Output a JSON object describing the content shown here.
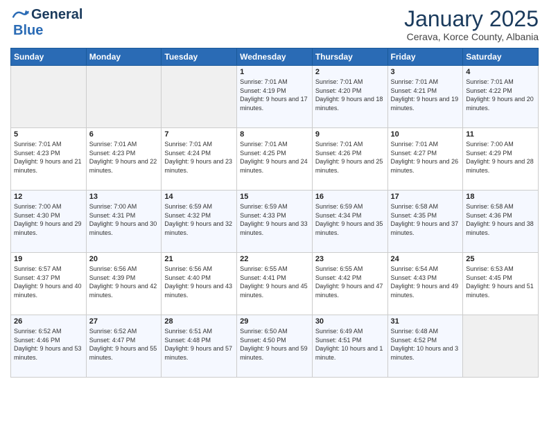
{
  "header": {
    "logo_line1": "General",
    "logo_line2": "Blue",
    "month": "January 2025",
    "location": "Cerava, Korce County, Albania"
  },
  "days_of_week": [
    "Sunday",
    "Monday",
    "Tuesday",
    "Wednesday",
    "Thursday",
    "Friday",
    "Saturday"
  ],
  "weeks": [
    [
      {
        "day": "",
        "info": ""
      },
      {
        "day": "",
        "info": ""
      },
      {
        "day": "",
        "info": ""
      },
      {
        "day": "1",
        "info": "Sunrise: 7:01 AM\nSunset: 4:19 PM\nDaylight: 9 hours and 17 minutes."
      },
      {
        "day": "2",
        "info": "Sunrise: 7:01 AM\nSunset: 4:20 PM\nDaylight: 9 hours and 18 minutes."
      },
      {
        "day": "3",
        "info": "Sunrise: 7:01 AM\nSunset: 4:21 PM\nDaylight: 9 hours and 19 minutes."
      },
      {
        "day": "4",
        "info": "Sunrise: 7:01 AM\nSunset: 4:22 PM\nDaylight: 9 hours and 20 minutes."
      }
    ],
    [
      {
        "day": "5",
        "info": "Sunrise: 7:01 AM\nSunset: 4:23 PM\nDaylight: 9 hours and 21 minutes."
      },
      {
        "day": "6",
        "info": "Sunrise: 7:01 AM\nSunset: 4:23 PM\nDaylight: 9 hours and 22 minutes."
      },
      {
        "day": "7",
        "info": "Sunrise: 7:01 AM\nSunset: 4:24 PM\nDaylight: 9 hours and 23 minutes."
      },
      {
        "day": "8",
        "info": "Sunrise: 7:01 AM\nSunset: 4:25 PM\nDaylight: 9 hours and 24 minutes."
      },
      {
        "day": "9",
        "info": "Sunrise: 7:01 AM\nSunset: 4:26 PM\nDaylight: 9 hours and 25 minutes."
      },
      {
        "day": "10",
        "info": "Sunrise: 7:01 AM\nSunset: 4:27 PM\nDaylight: 9 hours and 26 minutes."
      },
      {
        "day": "11",
        "info": "Sunrise: 7:00 AM\nSunset: 4:29 PM\nDaylight: 9 hours and 28 minutes."
      }
    ],
    [
      {
        "day": "12",
        "info": "Sunrise: 7:00 AM\nSunset: 4:30 PM\nDaylight: 9 hours and 29 minutes."
      },
      {
        "day": "13",
        "info": "Sunrise: 7:00 AM\nSunset: 4:31 PM\nDaylight: 9 hours and 30 minutes."
      },
      {
        "day": "14",
        "info": "Sunrise: 6:59 AM\nSunset: 4:32 PM\nDaylight: 9 hours and 32 minutes."
      },
      {
        "day": "15",
        "info": "Sunrise: 6:59 AM\nSunset: 4:33 PM\nDaylight: 9 hours and 33 minutes."
      },
      {
        "day": "16",
        "info": "Sunrise: 6:59 AM\nSunset: 4:34 PM\nDaylight: 9 hours and 35 minutes."
      },
      {
        "day": "17",
        "info": "Sunrise: 6:58 AM\nSunset: 4:35 PM\nDaylight: 9 hours and 37 minutes."
      },
      {
        "day": "18",
        "info": "Sunrise: 6:58 AM\nSunset: 4:36 PM\nDaylight: 9 hours and 38 minutes."
      }
    ],
    [
      {
        "day": "19",
        "info": "Sunrise: 6:57 AM\nSunset: 4:37 PM\nDaylight: 9 hours and 40 minutes."
      },
      {
        "day": "20",
        "info": "Sunrise: 6:56 AM\nSunset: 4:39 PM\nDaylight: 9 hours and 42 minutes."
      },
      {
        "day": "21",
        "info": "Sunrise: 6:56 AM\nSunset: 4:40 PM\nDaylight: 9 hours and 43 minutes."
      },
      {
        "day": "22",
        "info": "Sunrise: 6:55 AM\nSunset: 4:41 PM\nDaylight: 9 hours and 45 minutes."
      },
      {
        "day": "23",
        "info": "Sunrise: 6:55 AM\nSunset: 4:42 PM\nDaylight: 9 hours and 47 minutes."
      },
      {
        "day": "24",
        "info": "Sunrise: 6:54 AM\nSunset: 4:43 PM\nDaylight: 9 hours and 49 minutes."
      },
      {
        "day": "25",
        "info": "Sunrise: 6:53 AM\nSunset: 4:45 PM\nDaylight: 9 hours and 51 minutes."
      }
    ],
    [
      {
        "day": "26",
        "info": "Sunrise: 6:52 AM\nSunset: 4:46 PM\nDaylight: 9 hours and 53 minutes."
      },
      {
        "day": "27",
        "info": "Sunrise: 6:52 AM\nSunset: 4:47 PM\nDaylight: 9 hours and 55 minutes."
      },
      {
        "day": "28",
        "info": "Sunrise: 6:51 AM\nSunset: 4:48 PM\nDaylight: 9 hours and 57 minutes."
      },
      {
        "day": "29",
        "info": "Sunrise: 6:50 AM\nSunset: 4:50 PM\nDaylight: 9 hours and 59 minutes."
      },
      {
        "day": "30",
        "info": "Sunrise: 6:49 AM\nSunset: 4:51 PM\nDaylight: 10 hours and 1 minute."
      },
      {
        "day": "31",
        "info": "Sunrise: 6:48 AM\nSunset: 4:52 PM\nDaylight: 10 hours and 3 minutes."
      },
      {
        "day": "",
        "info": ""
      }
    ]
  ]
}
